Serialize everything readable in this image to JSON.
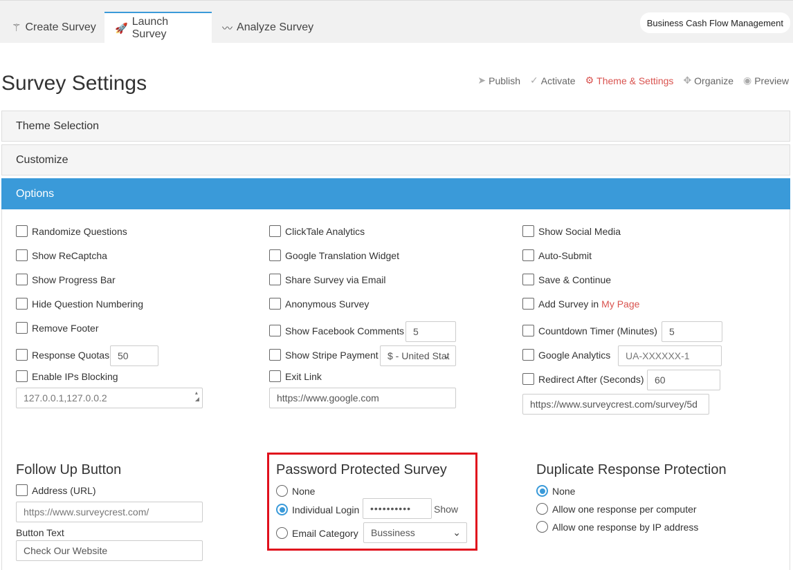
{
  "tabs": [
    {
      "label": "Create Survey",
      "icon": "magic-wand-icon"
    },
    {
      "label": "Launch Survey",
      "icon": "rocket-icon"
    },
    {
      "label": "Analyze Survey",
      "icon": "line-chart-icon"
    }
  ],
  "survey_name": "Business Cash Flow Management",
  "page_title": "Survey Settings",
  "actions": [
    {
      "label": "Publish",
      "icon": "paper-plane-icon"
    },
    {
      "label": "Activate",
      "icon": "check-icon"
    },
    {
      "label": "Theme & Settings",
      "icon": "gear-icon"
    },
    {
      "label": "Organize",
      "icon": "move-icon"
    },
    {
      "label": "Preview",
      "icon": "eye-icon"
    }
  ],
  "panels": {
    "theme": "Theme Selection",
    "customize": "Customize",
    "options": "Options"
  },
  "options": {
    "col1": {
      "randomize": "Randomize Questions",
      "recaptcha": "Show ReCaptcha",
      "progress": "Show Progress Bar",
      "hide_numbering": "Hide Question Numbering",
      "remove_footer": "Remove Footer",
      "quotas": "Response Quotas",
      "quotas_value": "50",
      "ip_block": "Enable IPs Blocking",
      "ip_value": "127.0.0.1,127.0.0.2"
    },
    "col2": {
      "clicktale": "ClickTale Analytics",
      "translation": "Google Translation Widget",
      "share_email": "Share Survey via Email",
      "anonymous": "Anonymous Survey",
      "fb_comments": "Show Facebook Comments",
      "fb_value": "5",
      "stripe": "Show Stripe Payment",
      "stripe_value": "$ - United Stat",
      "exit_link": "Exit Link",
      "exit_value": "https://www.google.com"
    },
    "col3": {
      "social": "Show Social Media",
      "autosubmit": "Auto-Submit",
      "save_continue": "Save & Continue",
      "add_survey": "Add Survey in",
      "my_page": "My Page",
      "countdown": "Countdown Timer (Minutes)",
      "countdown_value": "5",
      "ga": "Google Analytics",
      "ga_placeholder": "UA-XXXXXX-1",
      "redirect": "Redirect After (Seconds)",
      "redirect_value": "60",
      "redirect_url": "https://www.surveycrest.com/survey/5d"
    }
  },
  "follow_up": {
    "title": "Follow Up Button",
    "address": "Address (URL)",
    "address_placeholder": "https://www.surveycrest.com/",
    "button_text_label": "Button Text",
    "button_text_value": "Check Our Website"
  },
  "password": {
    "title": "Password Protected Survey",
    "none": "None",
    "individual": "Individual Login",
    "password_value": "••••••••••",
    "show": "Show",
    "email_category": "Email Category",
    "category_value": "Bussiness"
  },
  "duplicate": {
    "title": "Duplicate Response Protection",
    "none": "None",
    "per_computer": "Allow one response per computer",
    "per_ip": "Allow one response by IP address"
  }
}
